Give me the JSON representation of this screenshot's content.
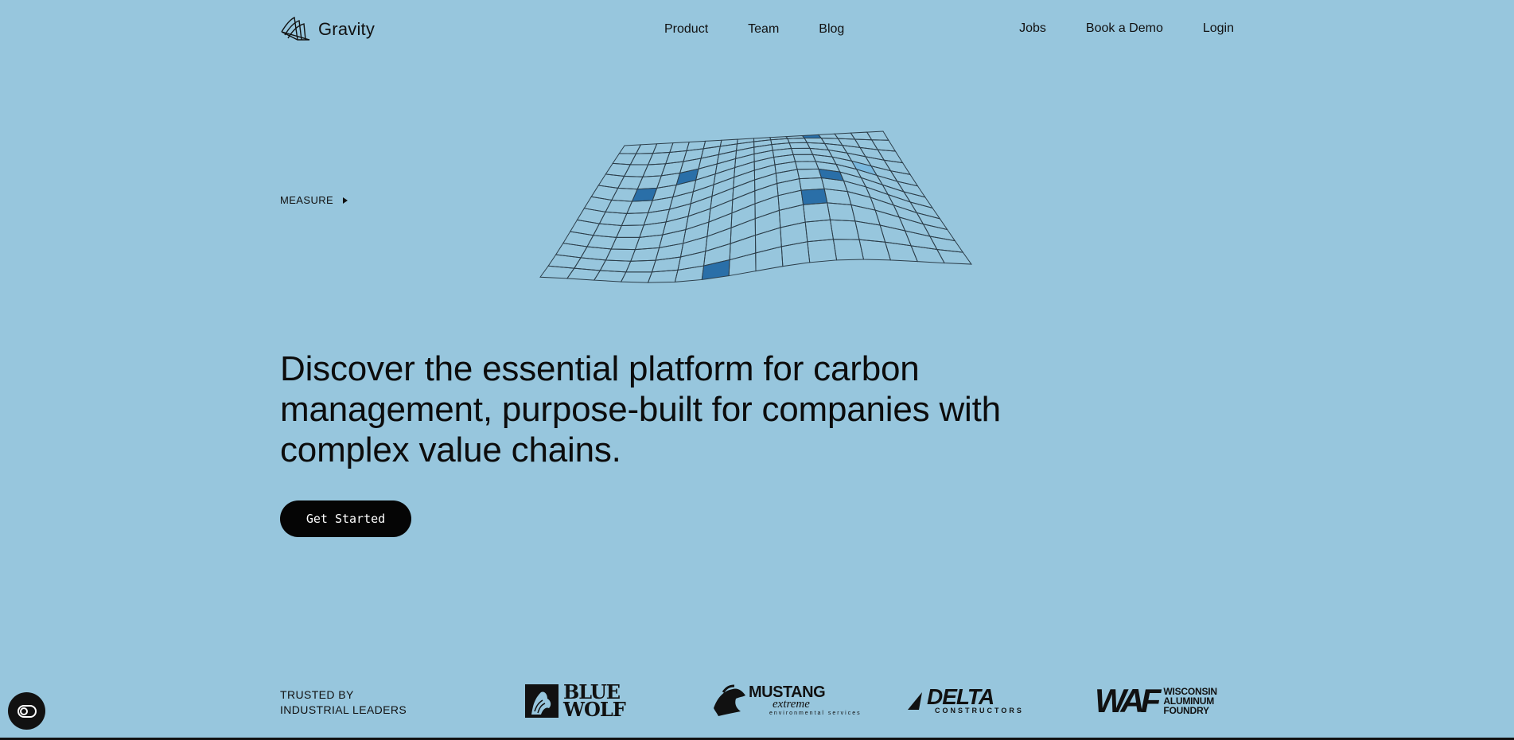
{
  "header": {
    "brand": "Gravity",
    "nav_center": [
      "Product",
      "Team",
      "Blog"
    ],
    "nav_right": [
      "Jobs",
      "Book a Demo",
      "Login"
    ]
  },
  "hero": {
    "section_label": "MEASURE",
    "headline": "Discover the essential platform for carbon management, purpose-built for companies with complex value chains.",
    "cta_label": "Get Started"
  },
  "trusted": {
    "line1": "TRUSTED BY",
    "line2": "INDUSTRIAL LEADERS",
    "logos": {
      "bluewolf_1": "BLUE",
      "bluewolf_2": "WOLF",
      "mustang_main": "MUSTANG",
      "mustang_sub": "extreme",
      "mustang_tag": "environmental services",
      "delta_main": "DELTA",
      "delta_sub": "CONSTRUCTORS",
      "waf_main": "WAF",
      "waf_1": "WISCONSIN",
      "waf_2": "ALUMINUM",
      "waf_3": "FOUNDRY"
    }
  },
  "colors": {
    "background": "#97c6dd",
    "text": "#111111",
    "button": "#050505",
    "grid_highlight_dark": "#2a6fa8",
    "grid_highlight_light": "#7ab8de"
  },
  "icons": {
    "logo": "gravity-logo-icon",
    "measure_arrow": "play-triangle-icon",
    "cookie": "cookie-preferences-icon"
  }
}
